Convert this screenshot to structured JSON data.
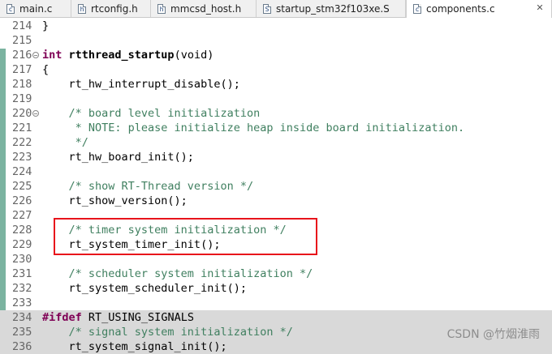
{
  "tabs": [
    {
      "icon": "c",
      "label": "main.c"
    },
    {
      "icon": "h",
      "label": "rtconfig.h"
    },
    {
      "icon": "h",
      "label": "mmcsd_host.h"
    },
    {
      "icon": "S",
      "label": "startup_stm32f103xe.S"
    },
    {
      "icon": "c",
      "label": "components.c",
      "active": true,
      "close": "✕"
    }
  ],
  "lines": [
    {
      "n": "214",
      "t": "}"
    },
    {
      "n": "215",
      "t": ""
    },
    {
      "n": "216",
      "t": "rtthread_startup",
      "kw": "int ",
      "tail": "(void)",
      "fold": true
    },
    {
      "n": "217",
      "t": "{"
    },
    {
      "n": "218",
      "t": "    rt_hw_interrupt_disable();"
    },
    {
      "n": "219",
      "t": ""
    },
    {
      "n": "220",
      "t": "    /* board level initialization",
      "cm": true,
      "fold": true
    },
    {
      "n": "221",
      "t": "     * NOTE: please initialize heap inside board initialization.",
      "cm": true
    },
    {
      "n": "222",
      "t": "     */",
      "cm": true
    },
    {
      "n": "223",
      "t": "    rt_hw_board_init();"
    },
    {
      "n": "224",
      "t": ""
    },
    {
      "n": "225",
      "t": "    /* show RT-Thread version */",
      "cm": true
    },
    {
      "n": "226",
      "t": "    rt_show_version();"
    },
    {
      "n": "227",
      "t": ""
    },
    {
      "n": "228",
      "t": "    /* timer system initialization */",
      "cm": true
    },
    {
      "n": "229",
      "t": "    rt_system_timer_init();"
    },
    {
      "n": "230",
      "t": ""
    },
    {
      "n": "231",
      "t": "    /* scheduler system initialization */",
      "cm": true
    },
    {
      "n": "232",
      "t": "    rt_system_scheduler_init();"
    },
    {
      "n": "233",
      "t": ""
    },
    {
      "n": "234",
      "t": " RT_USING_SIGNALS",
      "kw": "#ifdef",
      "hl": true
    },
    {
      "n": "235",
      "t": "    /* signal system initialization */",
      "cm": true,
      "hl": true
    },
    {
      "n": "236",
      "t": "    rt_system_signal_init();",
      "hl": true
    }
  ],
  "watermark": "CSDN @竹烟淮雨"
}
